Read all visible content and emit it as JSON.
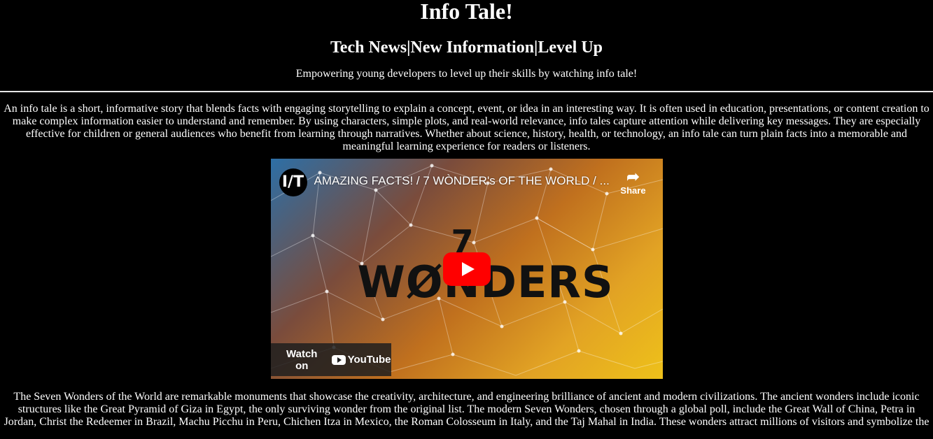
{
  "header": {
    "title": "Info Tale!",
    "subtitle": "Tech News|New Information|Level Up",
    "tagline": "Empowering young developers to level up their skills by watching info tale!"
  },
  "intro": {
    "text": "An info tale is a short, informative story that blends facts with engaging storytelling to explain a concept, event, or idea in an interesting way. It is often used in education, presentations, or content creation to make complex information easier to understand and remember. By using characters, simple plots, and real-world relevance, info tales capture attention while delivering key messages. They are especially effective for children or general audiences who benefit from learning through narratives. Whether about science, history, health, or technology, an info tale can turn plain facts into a memorable and meaningful learning experience for readers or listeners."
  },
  "video": {
    "channel_logo": "I/T",
    "title": "AMAZING FACTS! / 7 WÒNDER's OF THE WORLD / ...",
    "share_label": "Share",
    "thumb_number": "7",
    "thumb_word": "WØNDERS",
    "watch_on": "Watch on",
    "youtube_label": "YouTube",
    "icons": [
      "share-icon",
      "play-icon",
      "youtube-icon"
    ],
    "colors": {
      "play": "#ff0000"
    }
  },
  "wonders": {
    "text": "The Seven Wonders of the World are remarkable monuments that showcase the creativity, architecture, and engineering brilliance of ancient and modern civilizations. The ancient wonders include iconic structures like the Great Pyramid of Giza in Egypt, the only surviving wonder from the original list. The modern Seven Wonders, chosen through a global poll, include the Great Wall of China, Petra in Jordan, Christ the Redeemer in Brazil, Machu Picchu in Peru, Chichen Itza in Mexico, the Roman Colosseum in Italy, and the Taj Mahal in India. These wonders attract millions of visitors and symbolize the"
  }
}
